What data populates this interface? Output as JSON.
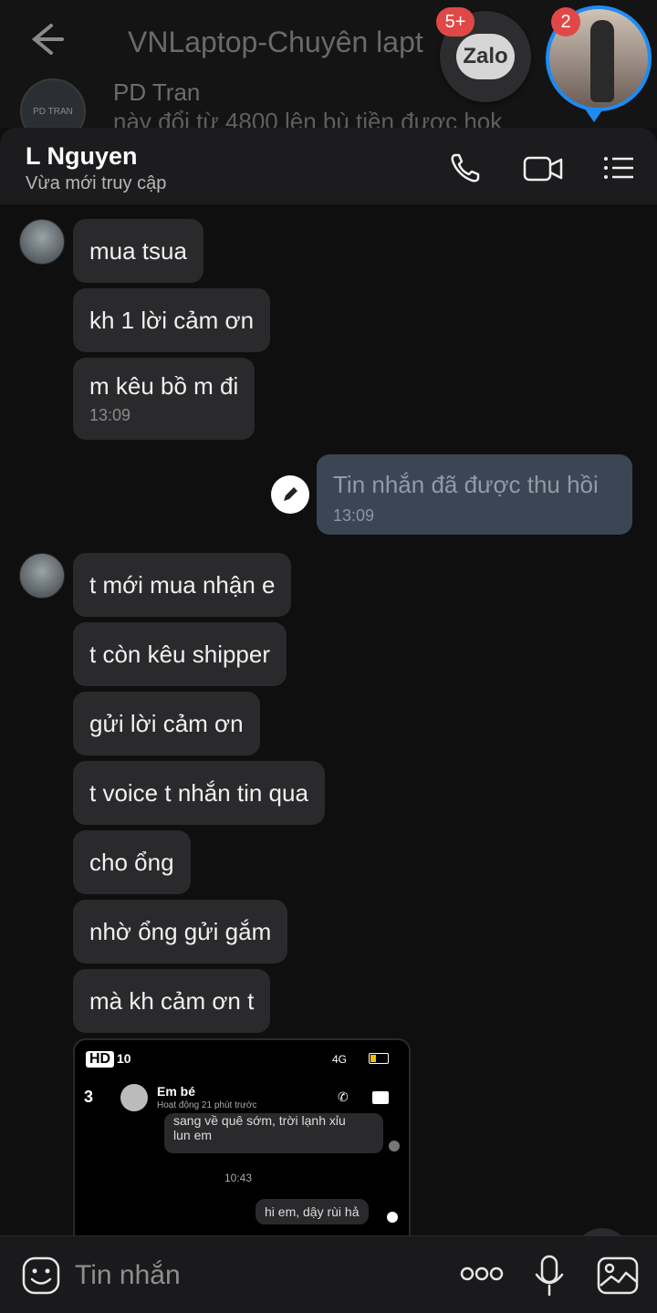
{
  "background": {
    "title": "VNLaptop-Chuyên lapt",
    "sender_name": "PD Tran",
    "avatar_text": "PD TRAN",
    "preview": "này đổi từ 4800 lên bù tiền được hok"
  },
  "floating": {
    "zalo_label": "Zalo",
    "zalo_badge": "5+",
    "avatar_badge": "2"
  },
  "header": {
    "contact_name": "L Nguyen",
    "status": "Vừa mới truy cập"
  },
  "messages_group1": [
    "mua tsua",
    "kh 1 lời cảm ơn",
    "m kêu bồ m đi"
  ],
  "time1": "13:09",
  "outgoing": {
    "text": "Tin nhắn đã được thu hồi",
    "time": "13:09"
  },
  "messages_group2": [
    "t mới mua nhận e",
    "t còn kêu shipper",
    "gửi lời cảm ơn",
    "t voice t nhắn tin qua",
    "cho ổng",
    "nhờ ổng gửi gắm",
    "mà kh cảm ơn t"
  ],
  "screenshot": {
    "hd": "HD",
    "clock": "10",
    "network": "4G",
    "back_count": "3",
    "name": "Em bé",
    "status": "Hoạt động 21 phút trước",
    "msg1_line1": "sang về quê sớm, trời lạnh xỉu",
    "msg1_line2": "lun em",
    "time": "10:43",
    "msg2": "hi em, dậy rùi hả"
  },
  "composer": {
    "placeholder": "Tin nhắn"
  }
}
